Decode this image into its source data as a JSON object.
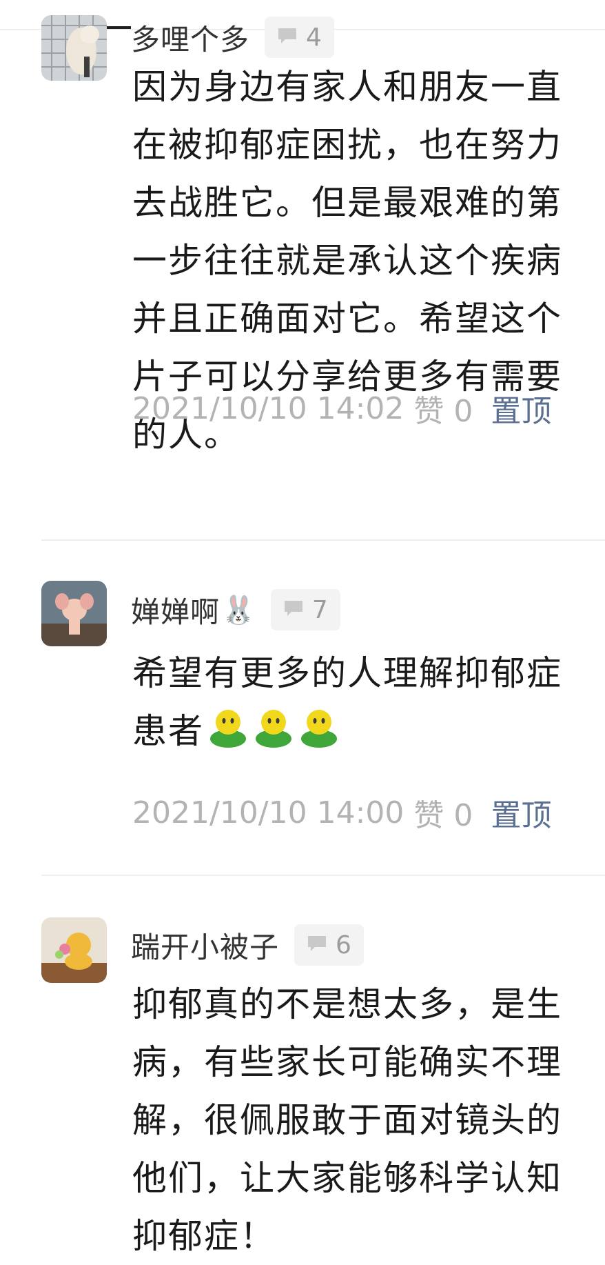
{
  "comments": [
    {
      "author": "多哩个多",
      "reply_count": "4",
      "text": "因为身边有家人和朋友一直在被抑郁症困扰，也在努力去战胜它。但是最艰难的第一步往往就是承认这个疾病并且正确面对它。希望这个片子可以分享给更多有需要的人。",
      "time": "2021/10/10 14:02",
      "like_label": "赞 0",
      "pin_label": "置顶"
    },
    {
      "author": "婵婵啊",
      "author_emoji": "🐰",
      "reply_count": "7",
      "text": "希望有更多的人理解抑郁症患者",
      "time": "2021/10/10 14:00",
      "like_label": "赞 0",
      "pin_label": "置顶"
    },
    {
      "author": "踹开小被子",
      "reply_count": "6",
      "text": "抑郁真的不是想太多，是生病，有些家长可能确实不理解，很佩服敢于面对镜头的他们，让大家能够科学认知抑郁症！"
    }
  ],
  "icons": {
    "reply": "comment-bubble-icon",
    "emoji": "green-smiley-emoji"
  },
  "colors": {
    "pin": "#5b6f92",
    "meta": "#b3b3b3",
    "badge_bg": "#f3f3f3"
  }
}
